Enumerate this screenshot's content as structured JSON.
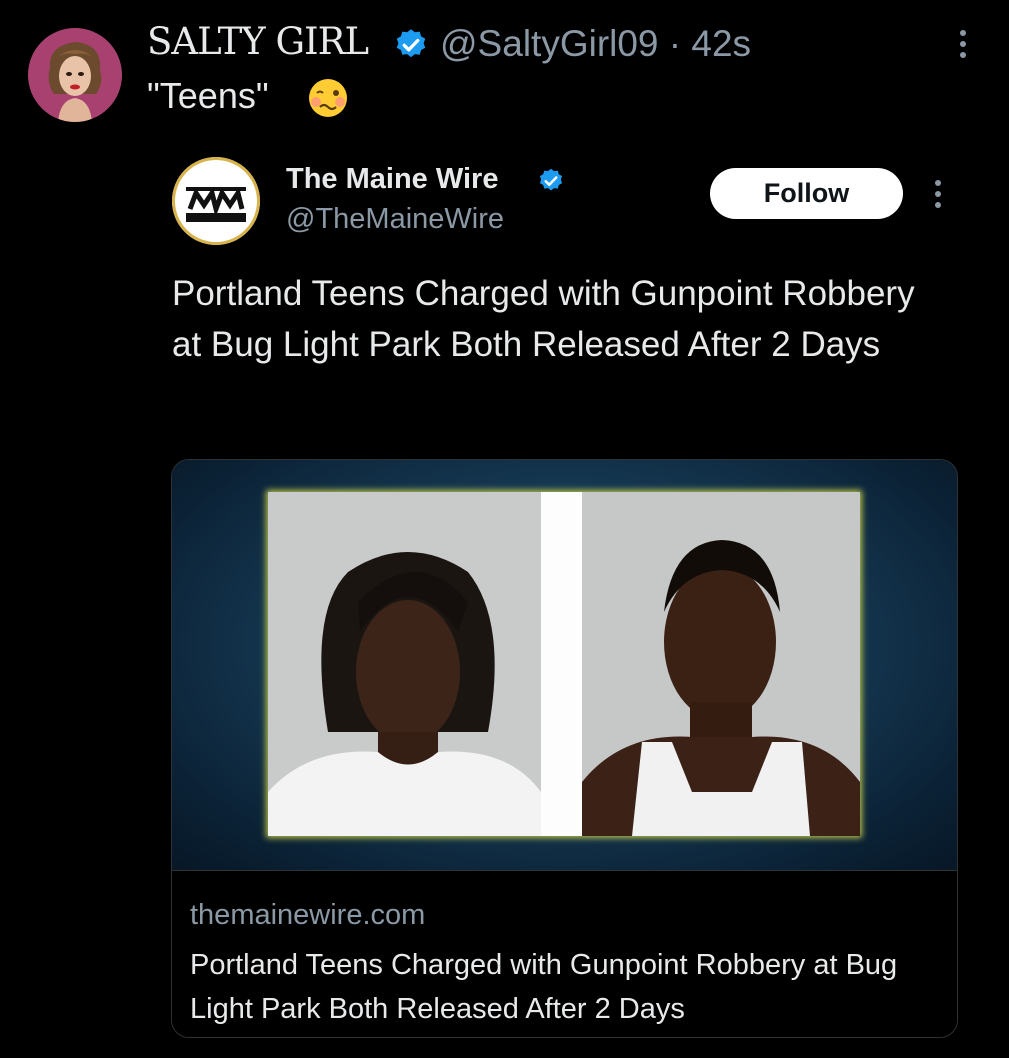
{
  "tweet": {
    "author_name": "SALTY GIRL",
    "handle_time": "@SaltyGirl09 · 42s",
    "text": "\"Teens\"",
    "emoji": "woozy-face-emoji"
  },
  "quoted": {
    "name": "The Maine Wire",
    "handle": "@TheMaineWire",
    "follow_label": "Follow",
    "logo_text": "MAINE WIRE",
    "headline": "Portland Teens Charged with Gunpoint Robbery at Bug Light Park Both Released After 2 Days"
  },
  "card": {
    "domain": "themainewire.com",
    "title": "Portland Teens Charged with Gunpoint Robbery at Bug Light Park Both Released After 2 Days"
  },
  "colors": {
    "background": "#000000",
    "verified": "#1d9bf0",
    "secondary_text": "#8b98a5"
  }
}
